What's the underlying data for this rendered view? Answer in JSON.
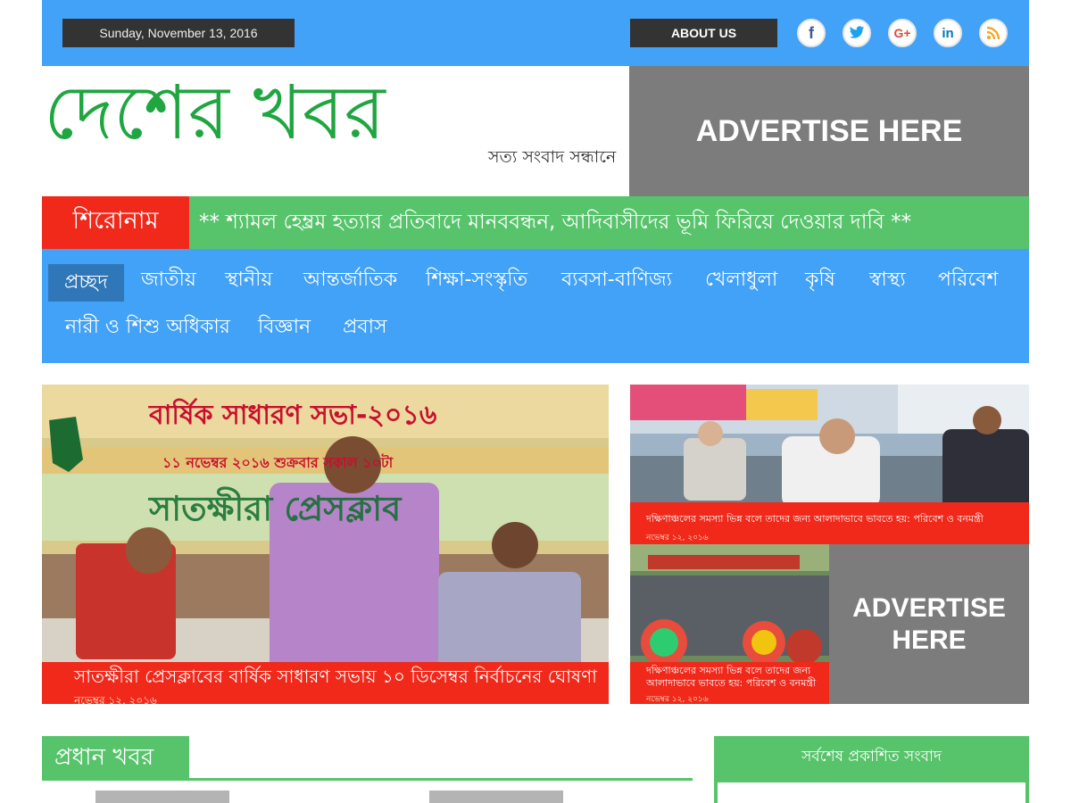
{
  "header": {
    "date": "Sunday, November 13, 2016",
    "about_label": "ABOUT US",
    "social": [
      {
        "name": "facebook-icon",
        "glyph": "f",
        "color": "#3b5998"
      },
      {
        "name": "twitter-icon",
        "glyph": "t",
        "color": "#1da1f2"
      },
      {
        "name": "google-plus-icon",
        "glyph": "G+",
        "color": "#dd4b39"
      },
      {
        "name": "linkedin-icon",
        "glyph": "in",
        "color": "#0077b5"
      },
      {
        "name": "rss-icon",
        "glyph": "rss",
        "color": "#f7a21b"
      }
    ]
  },
  "logo": {
    "title": "দেশের খবর",
    "tagline": "সত্য সংবাদ সন্ধানে"
  },
  "ads": {
    "top": "ADVERTISE HERE",
    "side": "ADVERTISE HERE"
  },
  "breaking": {
    "label": "শিরোনাম",
    "text": "** শ্যামল হেম্ব্রম হত্যার প্রতিবাদে মানববন্ধন, আদিবাসীদের ভূমি ফিরিয়ে দেওয়ার দাবি **"
  },
  "nav": {
    "items": [
      "প্রচ্ছদ",
      "জাতীয়",
      "স্থানীয়",
      "আন্তর্জাতিক",
      "শিক্ষা-সংস্কৃতি",
      "ব্যবসা-বাণিজ্য",
      "খেলাধুলা",
      "কৃষি",
      "স্বাস্থ্য",
      "পরিবেশ",
      "নারী ও শিশু অধিকার",
      "বিজ্ঞান",
      "প্রবাস"
    ]
  },
  "featured": {
    "main": {
      "banner_line1": "বার্ষিক সাধারণ সভা-২০১৬",
      "banner_line2": "১১ নভেম্বর ২০১৬ শুক্রবার সকাল ১০টা",
      "banner_line3": "সাতক্ষীরা প্রেসক্লাব",
      "title": "সাতক্ষীরা প্রেসক্লাবের বার্ষিক সাধারণ সভায় ১০ ডিসেম্বর নির্বাচনের ঘোষণা",
      "date": "নভেম্বর ১২, ২০১৬"
    },
    "side1": {
      "title": "দক্ষিণাঞ্চলের সমস্যা ভিন্ন বলে তাদের জন্য আলাদাভাবে ভাবতে হয়: পরিবেশ ও বনমন্ত্রী",
      "date": "নভেম্বর ১২, ২০১৬"
    },
    "side2": {
      "title": "দক্ষিণাঞ্চলের সমস্যা ভিন্ন বলে তাদের জন্য আলাদাভাবে ভাবতে হয়: পরিবেশ ও বনমন্ত্রী",
      "date": "নভেম্বর ১২, ২০১৬"
    }
  },
  "sections": {
    "main_news": "প্রধান খবর",
    "latest": "সর্বশেষ প্রকাশিত সংবাদ"
  },
  "colors": {
    "blue": "#42a2f7",
    "green": "#57c46b",
    "red": "#f0291b",
    "gray": "#7c7c7c",
    "dark": "#333333"
  }
}
